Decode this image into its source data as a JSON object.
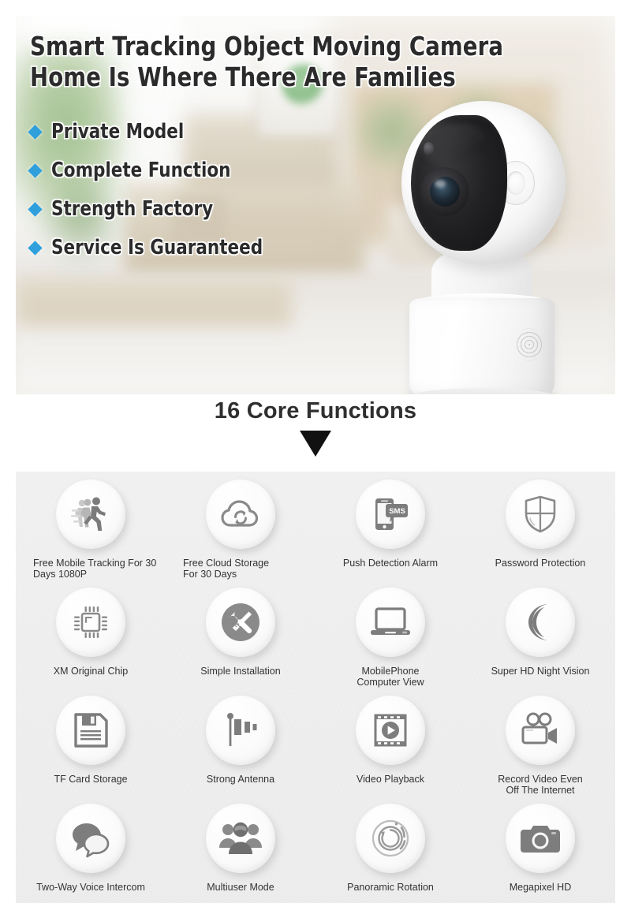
{
  "hero": {
    "headline_line1": "Smart Tracking Object Moving Camera",
    "headline_line2": "Home Is Where There Are Families",
    "bullets": [
      {
        "label": "Private Model"
      },
      {
        "label": "Complete Function"
      },
      {
        "label": "Strength Factory"
      },
      {
        "label": "Service Is Guaranteed"
      }
    ],
    "bullet_color": "#2fa0dc",
    "product_icon": "wifi-security-camera"
  },
  "mid": {
    "title": "16 Core Functions",
    "arrow_icon": "chevron-down-arrow-icon"
  },
  "features": {
    "items": [
      {
        "label_line1": "Free Mobile Tracking For 30",
        "label_line2": "Days 1080P",
        "icon": "running-person-motion-icon",
        "align": "left"
      },
      {
        "label_line1": "Free Cloud Storage",
        "label_line2": "For 30 Days",
        "icon": "cloud-sync-icon",
        "align": "left"
      },
      {
        "label_line1": "Push Detection Alarm",
        "label_line2": "",
        "icon": "phone-sms-alert-icon",
        "align": "center"
      },
      {
        "label_line1": "Password Protection",
        "label_line2": "",
        "icon": "shield-icon",
        "align": "center"
      },
      {
        "label_line1": "XM Original Chip",
        "label_line2": "",
        "icon": "microchip-icon",
        "align": "center"
      },
      {
        "label_line1": "Simple Installation",
        "label_line2": "",
        "icon": "wrench-screwdriver-icon",
        "align": "center"
      },
      {
        "label_line1": "MobilePhone",
        "label_line2": "Computer View",
        "icon": "laptop-icon",
        "align": "center"
      },
      {
        "label_line1": "Super HD Night Vision",
        "label_line2": "",
        "icon": "crescent-moon-icon",
        "align": "center"
      },
      {
        "label_line1": "TF Card Storage",
        "label_line2": "",
        "icon": "floppy-disk-icon",
        "align": "center"
      },
      {
        "label_line1": "Strong Antenna",
        "label_line2": "",
        "icon": "antenna-signal-icon",
        "align": "center"
      },
      {
        "label_line1": "Video Playback",
        "label_line2": "",
        "icon": "film-play-icon",
        "align": "center"
      },
      {
        "label_line1": "Record Video Even",
        "label_line2": "Off The Internet",
        "icon": "video-camera-icon",
        "align": "center"
      },
      {
        "label_line1": "Two-Way Voice Intercom",
        "label_line2": "",
        "icon": "speech-bubbles-icon",
        "align": "center"
      },
      {
        "label_line1": "Multiuser Mode",
        "label_line2": "",
        "icon": "group-users-icon",
        "align": "center"
      },
      {
        "label_line1": "Panoramic Rotation",
        "label_line2": "",
        "icon": "rotation-arrow-icon",
        "align": "center"
      },
      {
        "label_line1": "Megapixel HD",
        "label_line2": "",
        "icon": "photo-camera-icon",
        "align": "center"
      }
    ]
  }
}
